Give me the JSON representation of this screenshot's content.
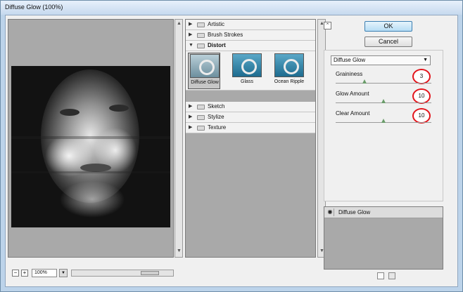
{
  "window": {
    "title": "Diffuse Glow (100%)"
  },
  "preview": {
    "zoom_out_label": "−",
    "zoom_in_label": "+",
    "zoom": "100%",
    "zoom_caret": "▼",
    "scroll_up": "▲",
    "scroll_down": "▼",
    "hscroll_grip": "|||"
  },
  "categories": {
    "items": [
      {
        "label": "Artistic",
        "expanded": false,
        "arrow": "▶"
      },
      {
        "label": "Brush Strokes",
        "expanded": false,
        "arrow": "▶"
      },
      {
        "label": "Distort",
        "expanded": true,
        "arrow": "▼"
      },
      {
        "label": "Sketch",
        "expanded": false,
        "arrow": "▶"
      },
      {
        "label": "Stylize",
        "expanded": false,
        "arrow": "▶"
      },
      {
        "label": "Texture",
        "expanded": false,
        "arrow": "▶"
      }
    ],
    "distort_filters": [
      {
        "label": "Diffuse Glow",
        "selected": true
      },
      {
        "label": "Glass",
        "selected": false
      },
      {
        "label": "Ocean Ripple",
        "selected": false
      }
    ],
    "scroll_up": "▲",
    "scroll_down": "▼"
  },
  "panel": {
    "collapse_icon": "⌃",
    "ok_label": "OK",
    "cancel_label": "Cancel",
    "filter_select": "Diffuse Glow",
    "select_caret": "▼",
    "params": [
      {
        "label": "Graininess",
        "value": "3",
        "slider_fraction": 0.3
      },
      {
        "label": "Glow Amount",
        "value": "10",
        "slider_fraction": 0.5
      },
      {
        "label": "Clear Amount",
        "value": "10",
        "slider_fraction": 0.5
      }
    ]
  },
  "layers": {
    "items": [
      {
        "label": "Diffuse Glow",
        "visible_icon": "◉"
      }
    ]
  },
  "colors": {
    "highlight_circle": "#e3141b",
    "ok_accent": "#3c7fb1"
  }
}
